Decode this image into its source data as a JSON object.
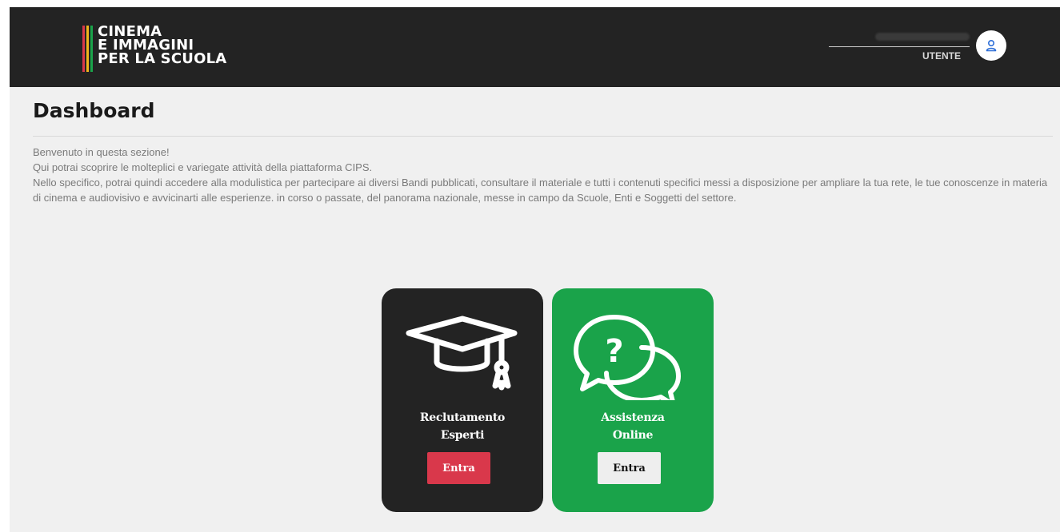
{
  "header": {
    "logo": {
      "lines": [
        "CINEMA",
        "E IMMAGINI",
        "PER LA SCUOLA"
      ],
      "bar_colors": [
        "#d9384b",
        "#f2b51c",
        "#1aa34a"
      ]
    },
    "user": {
      "label": "UTENTE",
      "icon": "user-icon"
    }
  },
  "main": {
    "title": "Dashboard",
    "intro": [
      "Benvenuto in questa sezione!",
      "Qui potrai scoprire le molteplici e variegate attività della piattaforma CIPS.",
      "Nello specifico, potrai quindi accedere alla modulistica per partecipare ai diversi Bandi pubblicati, consultare il materiale e tutti i contenuti specifici messi a disposizione per ampliare la tua rete, le tue conoscenze in materia di cinema e audiovisivo e avvicinarti alle esperienze. in corso o passate, del panorama nazionale, messe in campo da Scuole, Enti e Soggetti del settore."
    ],
    "cards": [
      {
        "title_line1": "Reclutamento",
        "title_line2": "Esperti",
        "button": "Entra",
        "icon": "graduation-cap-icon",
        "color": "#232323",
        "button_color": "#d9384b"
      },
      {
        "title_line1": "Assistenza",
        "title_line2": "Online",
        "button": "Entra",
        "icon": "question-chat-icon",
        "color": "#1aa34a",
        "button_color": "#eeeeee"
      }
    ]
  }
}
